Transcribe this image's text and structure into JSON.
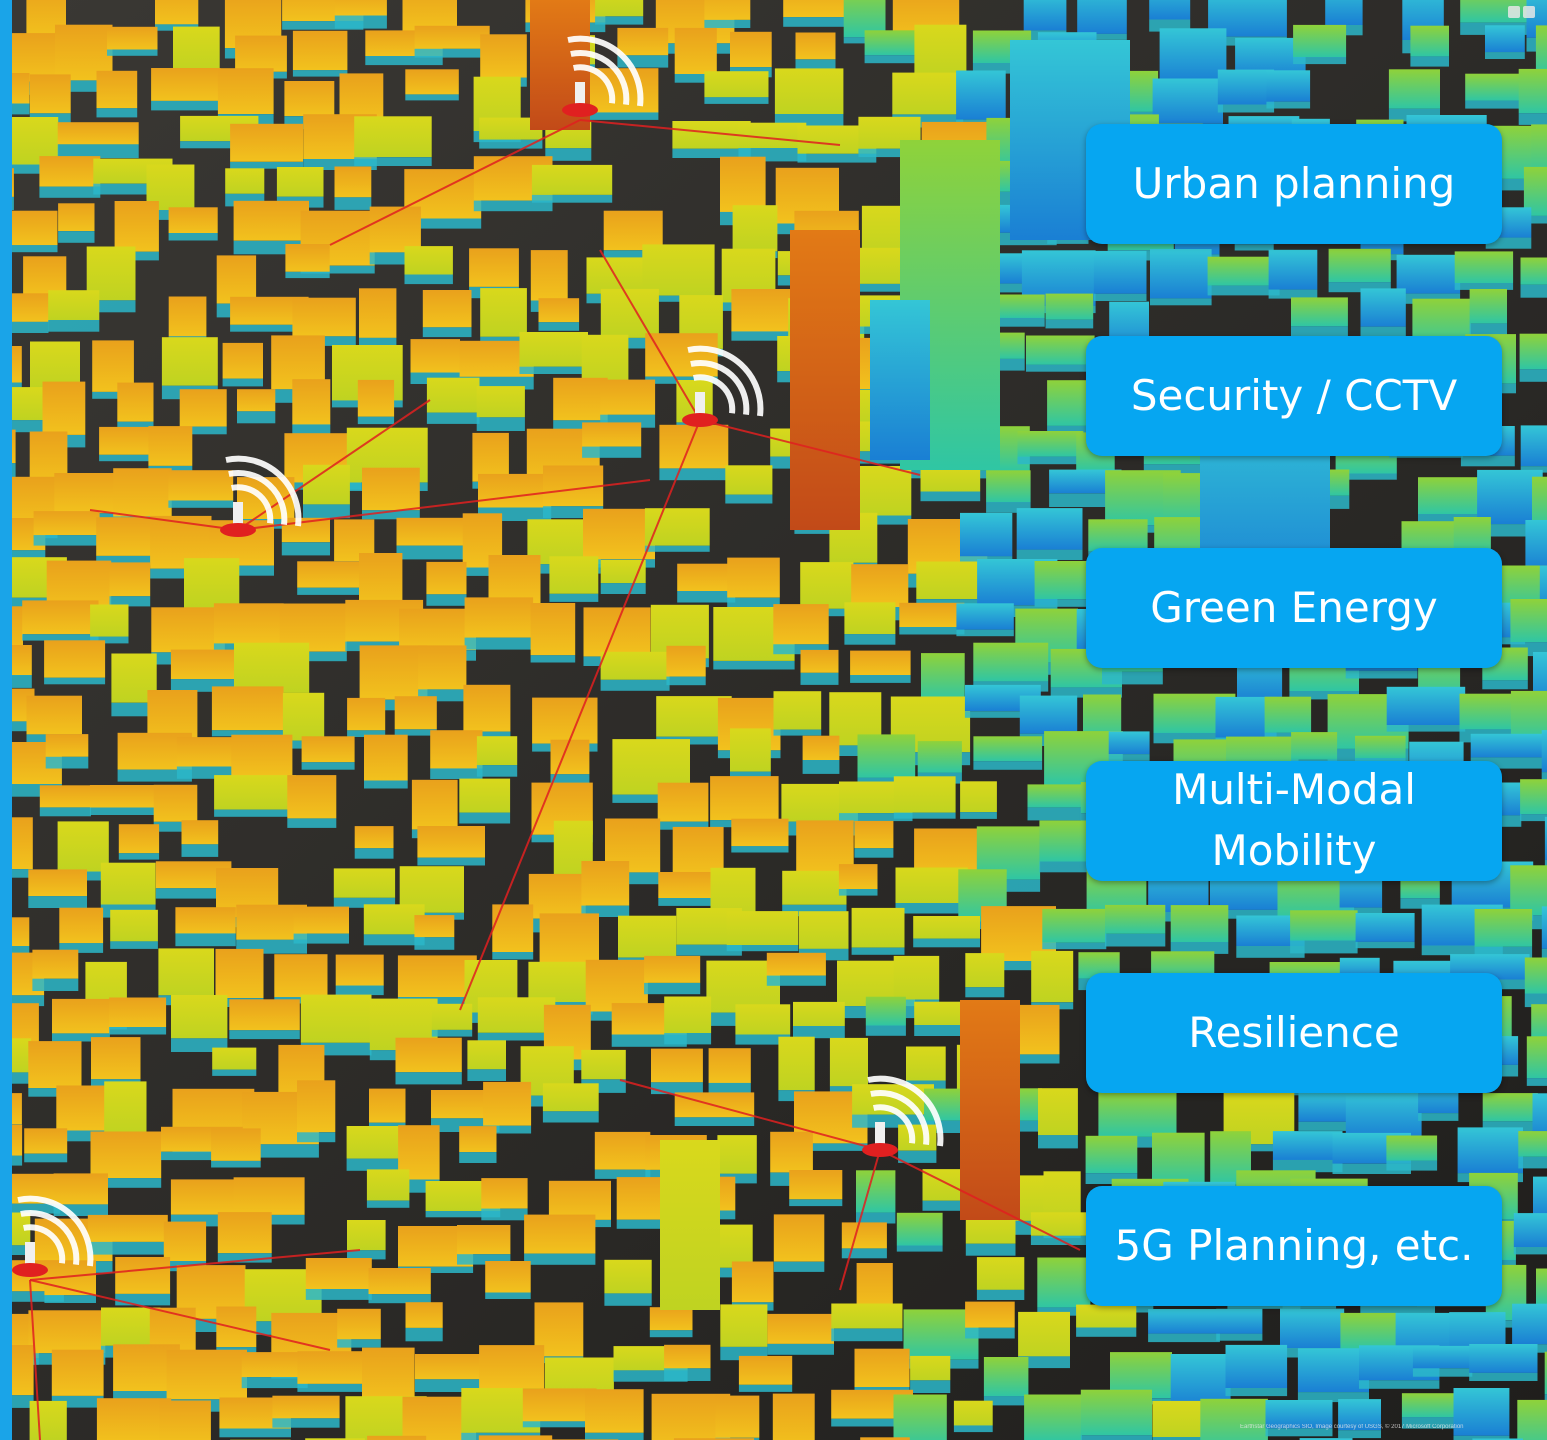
{
  "cards": [
    {
      "label": "Urban planning"
    },
    {
      "label": "Security / CCTV"
    },
    {
      "label": "Green Energy"
    },
    {
      "label": "Multi-Modal\nMobility"
    },
    {
      "label": "Resilience"
    },
    {
      "label": "5G Planning, etc."
    }
  ],
  "colors": {
    "card_bg": "#06a6f1",
    "card_text": "#ffffff",
    "heat_low": "#1fa8df",
    "heat_mid": "#e6d11a",
    "heat_high": "#c8461a",
    "signal_line": "#e02020"
  },
  "attribution": "Earthstar Geographics SIO, Image courtesy of USGS, © 2017 Microsoft Corporation"
}
